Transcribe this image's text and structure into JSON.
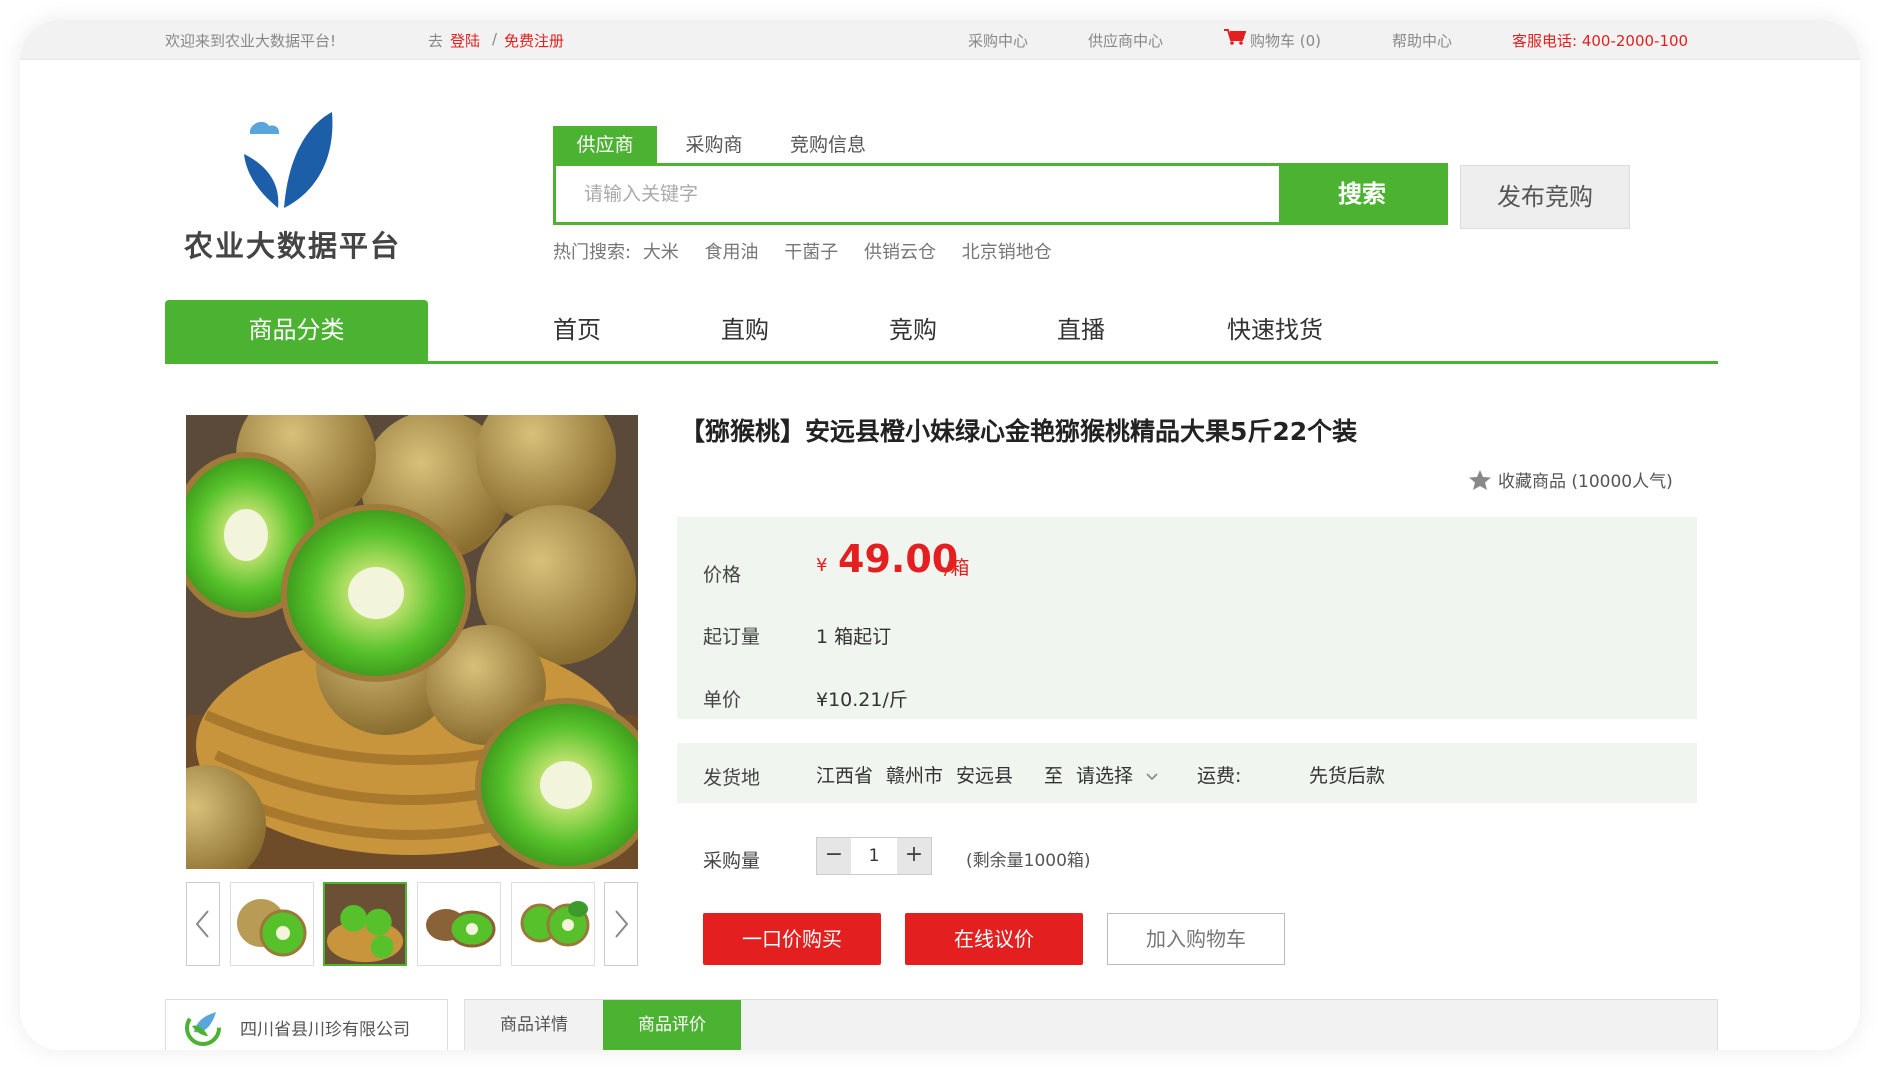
{
  "topbar": {
    "welcome": "欢迎来到农业大数据平台!",
    "go_prefix": "去",
    "login": "登陆",
    "slash": "/",
    "register": "免费注册",
    "purchase_center": "采购中心",
    "supplier_center": "供应商中心",
    "cart": "购物车 (0)",
    "help": "帮助中心",
    "hotline": "客服电话: 400-2000-100"
  },
  "header": {
    "logo_text": "农业大数据平台",
    "search_tabs": [
      "供应商",
      "采购商",
      "竞购信息"
    ],
    "search_placeholder": "请输入关键字",
    "search_button": "搜索",
    "publish_button": "发布竞购",
    "hot_label": "热门搜索:",
    "hot_terms": [
      "大米",
      "食用油",
      "干菌子",
      "供销云仓",
      "北京销地仓"
    ]
  },
  "nav": {
    "category": "商品分类",
    "items": [
      "首页",
      "直购",
      "竞购",
      "直播",
      "快速找货"
    ]
  },
  "product": {
    "title": "【猕猴桃】安远县橙小妹绿心金艳猕猴桃精品大果5斤22个装",
    "favorite": "收藏商品 (10000人气)",
    "price_label": "价格",
    "price_currency": "¥",
    "price": "49.00",
    "price_unit": "/箱",
    "moq_label": "起订量",
    "moq_value": "1 箱起订",
    "unit_price_label": "单价",
    "unit_price": "¥10.21/斤",
    "ship_label": "发货地",
    "ship_province": "江西省",
    "ship_city": "赣州市",
    "ship_county": "安远县",
    "ship_to": "至",
    "ship_select": "请选择",
    "freight_label": "运费:",
    "freight_value": "先货后款",
    "qty_label": "采购量",
    "qty_minus": "−",
    "qty_value": "1",
    "qty_plus": "+",
    "remain": "(剩余量1000箱)",
    "buy_button": "一口价购买",
    "negotiate_button": "在线议价",
    "cart_button": "加入购物车"
  },
  "bottom": {
    "shop_name": "四川省县川珍有限公司",
    "tabs": [
      "商品详情",
      "商品评价"
    ]
  },
  "colors": {
    "brand_green": "#4cb232",
    "accent_red": "#e41f1f",
    "logo_blue": "#1d5ea8",
    "cloud_blue": "#5aa6dc"
  },
  "icons": [
    "cart-icon",
    "star-icon",
    "chevron-down-icon",
    "chevron-left-icon",
    "chevron-right-icon",
    "leaf-logo-icon",
    "shop-logo-icon"
  ]
}
